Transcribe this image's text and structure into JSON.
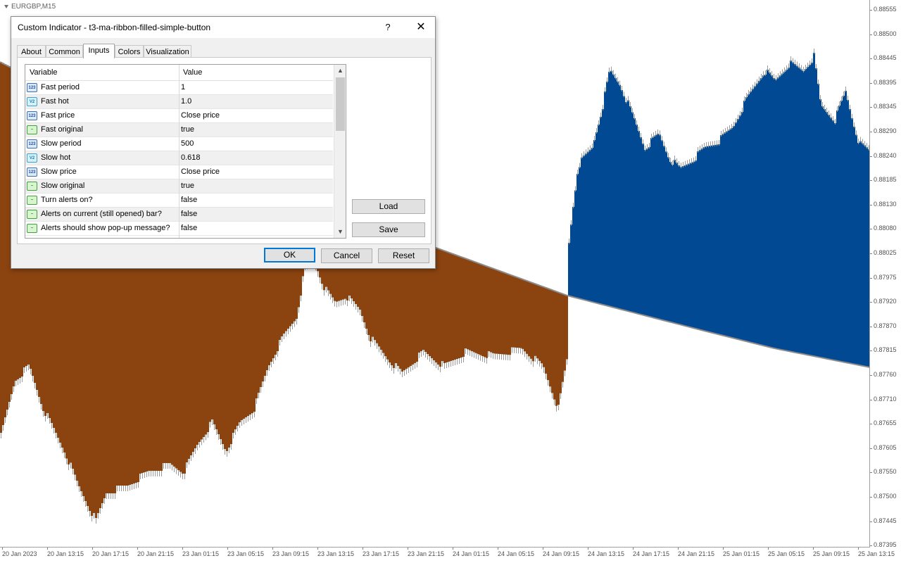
{
  "chart": {
    "symbol": "EURGBP,M15",
    "bull_color": "#014a93",
    "bear_color": "#8b4310",
    "price_labels": [
      "0.88555",
      "0.88500",
      "0.88445",
      "0.88395",
      "0.88345",
      "0.88290",
      "0.88240",
      "0.88185",
      "0.88130",
      "0.88080",
      "0.88025",
      "0.87975",
      "0.87920",
      "0.87870",
      "0.87815",
      "0.87760",
      "0.87710",
      "0.87655",
      "0.87605",
      "0.87550",
      "0.87500",
      "0.87445",
      "0.87395"
    ],
    "time_labels": [
      "20 Jan 2023",
      "20 Jan 13:15",
      "20 Jan 17:15",
      "20 Jan 21:15",
      "23 Jan 01:15",
      "23 Jan 05:15",
      "23 Jan 09:15",
      "23 Jan 13:15",
      "23 Jan 17:15",
      "23 Jan 21:15",
      "24 Jan 01:15",
      "24 Jan 05:15",
      "24 Jan 09:15",
      "24 Jan 13:15",
      "24 Jan 17:15",
      "24 Jan 21:15",
      "25 Jan 01:15",
      "25 Jan 05:15",
      "25 Jan 09:15",
      "25 Jan 13:15"
    ]
  },
  "dialog": {
    "title": "Custom Indicator - t3-ma-ribbon-filled-simple-button",
    "help": "?",
    "close": "✕",
    "tabs": [
      {
        "label": "About"
      },
      {
        "label": "Common"
      },
      {
        "label": "Inputs",
        "active": true
      },
      {
        "label": "Colors"
      },
      {
        "label": "Visualization"
      }
    ],
    "grid": {
      "col_variable": "Variable",
      "col_value": "Value",
      "rows": [
        {
          "type": "int",
          "icon": "123",
          "variable": "Fast period",
          "value": "1"
        },
        {
          "type": "dbl",
          "icon": "V2",
          "variable": "Fast hot",
          "value": "1.0"
        },
        {
          "type": "int",
          "icon": "123",
          "variable": "Fast price",
          "value": "Close price"
        },
        {
          "type": "bool",
          "icon": "~",
          "variable": "Fast original",
          "value": "true"
        },
        {
          "type": "int",
          "icon": "123",
          "variable": "Slow period",
          "value": "500"
        },
        {
          "type": "dbl",
          "icon": "V2",
          "variable": "Slow hot",
          "value": "0.618"
        },
        {
          "type": "int",
          "icon": "123",
          "variable": "Slow price",
          "value": "Close price"
        },
        {
          "type": "bool",
          "icon": "~",
          "variable": "Slow original",
          "value": "true"
        },
        {
          "type": "bool",
          "icon": "~",
          "variable": "Turn alerts on?",
          "value": "false"
        },
        {
          "type": "bool",
          "icon": "~",
          "variable": "Alerts on current (still opened) bar?",
          "value": "false"
        },
        {
          "type": "bool",
          "icon": "~",
          "variable": "Alerts should show pop-up message?",
          "value": "false"
        }
      ]
    },
    "buttons": {
      "load": "Load",
      "save": "Save",
      "ok": "OK",
      "cancel": "Cancel",
      "reset": "Reset"
    }
  }
}
